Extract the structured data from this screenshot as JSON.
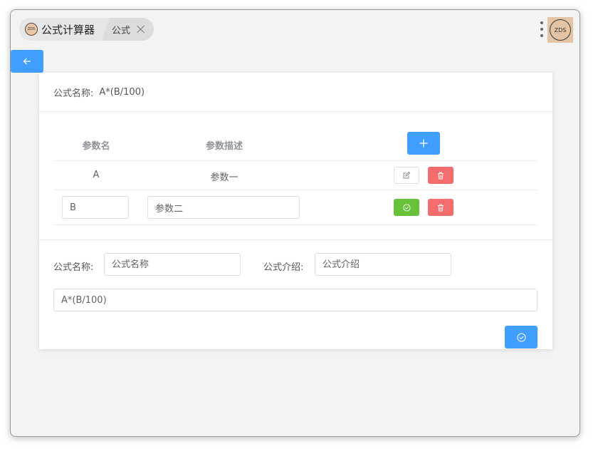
{
  "tabs": [
    {
      "logo_text": "ZDS",
      "label": "公式计算器"
    },
    {
      "label": "公式"
    }
  ],
  "avatar_text": "ZDS",
  "header": {
    "label": "公式名称:",
    "value": "A*(B/100)"
  },
  "table": {
    "columns": [
      "参数名",
      "参数描述"
    ],
    "rows": [
      {
        "name": "A",
        "description": "参数一"
      }
    ],
    "edit_row": {
      "name": "B",
      "description": "参数二"
    }
  },
  "form": {
    "name_label": "公式名称:",
    "name_placeholder": "公式名称",
    "desc_label": "公式介绍:",
    "desc_placeholder": "公式介绍",
    "formula_value": "A*(B/100)"
  },
  "colors": {
    "primary": "#409eff",
    "success": "#67c23a",
    "danger": "#f56c6c"
  },
  "icons": {
    "back": "arrow-left-icon",
    "add": "plus-icon",
    "edit": "edit-icon",
    "delete": "trash-icon",
    "confirm": "check-circle-icon"
  }
}
